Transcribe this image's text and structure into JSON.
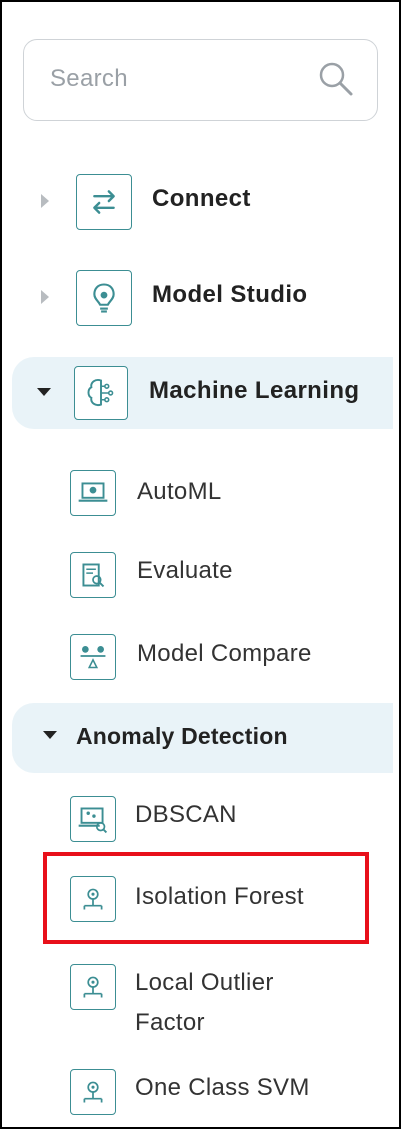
{
  "search": {
    "placeholder": "Search"
  },
  "top_items": [
    {
      "label": "Connect",
      "icon": "arrows-exchange-icon",
      "expanded": false
    },
    {
      "label": "Model Studio",
      "icon": "bulb-gear-icon",
      "expanded": false
    },
    {
      "label": "Machine Learning",
      "icon": "brain-icon",
      "expanded": true
    }
  ],
  "ml_items": [
    {
      "label": "AutoML",
      "icon": "laptop-gear-icon"
    },
    {
      "label": "Evaluate",
      "icon": "clipboard-search-icon"
    },
    {
      "label": "Model Compare",
      "icon": "scale-compare-icon"
    }
  ],
  "anomaly": {
    "label": "Anomaly Detection",
    "expanded": true,
    "items": [
      {
        "label": "DBSCAN",
        "icon": "laptop-scatter-icon"
      },
      {
        "label": "Isolation Forest",
        "icon": "anomaly-node-icon",
        "selected": true
      },
      {
        "label_line1": "Local Outlier",
        "label_line2": "Factor",
        "icon": "anomaly-node-icon"
      },
      {
        "label": "One Class SVM",
        "icon": "anomaly-node-icon"
      }
    ]
  },
  "colors": {
    "accent": "#3c8e93",
    "highlight_bg": "#e9f3f8",
    "selection_border": "#e8101a"
  }
}
